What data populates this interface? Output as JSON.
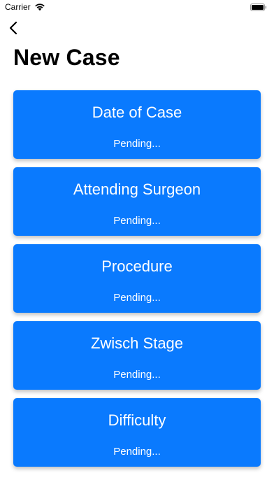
{
  "status_bar": {
    "carrier": "Carrier",
    "wifi_icon": "wifi-icon",
    "battery_icon": "battery-icon"
  },
  "nav": {
    "back_icon": "chevron-left-icon",
    "title": "New Case"
  },
  "colors": {
    "card_background": "#0a7afe",
    "card_text": "#ffffff"
  },
  "cards": [
    {
      "title": "Date of Case",
      "status": "Pending..."
    },
    {
      "title": "Attending Surgeon",
      "status": "Pending..."
    },
    {
      "title": "Procedure",
      "status": "Pending..."
    },
    {
      "title": "Zwisch Stage",
      "status": "Pending..."
    },
    {
      "title": "Difficulty",
      "status": "Pending..."
    }
  ]
}
